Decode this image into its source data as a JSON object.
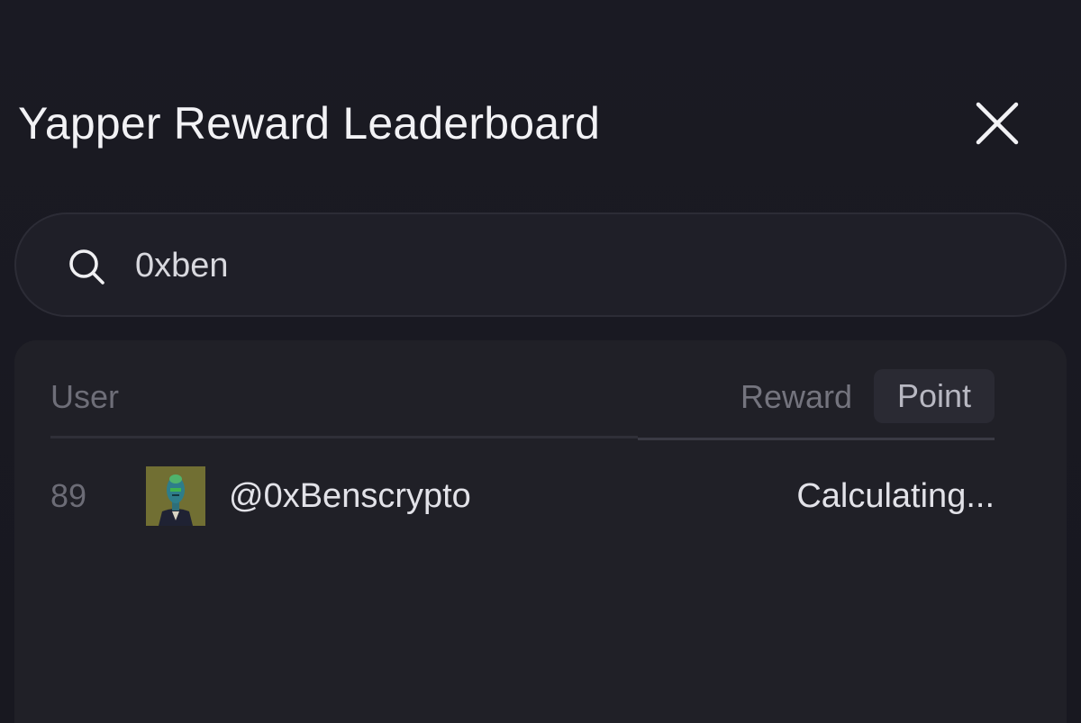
{
  "header": {
    "title": "Yapper Reward Leaderboard",
    "close_icon": "close-icon"
  },
  "search": {
    "icon": "search-icon",
    "value": "0xben"
  },
  "table": {
    "columns": {
      "user": "User",
      "reward": "Reward",
      "point": "Point"
    },
    "active_tab": "Point",
    "rows": [
      {
        "rank": "89",
        "username": "@0xBenscrypto",
        "value": "Calculating..."
      }
    ]
  },
  "colors": {
    "background": "#181820",
    "panel": "#202027",
    "search_bg": "#1f1f28",
    "text": "#ececf1",
    "muted": "#6e6e78"
  }
}
